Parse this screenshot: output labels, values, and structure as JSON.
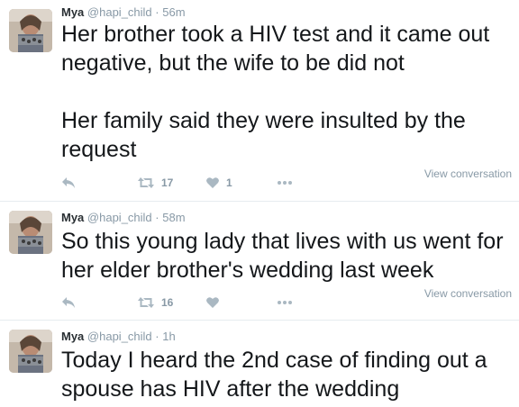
{
  "tweets": [
    {
      "name": "Mya",
      "handle": "@hapi_child",
      "separator": "·",
      "time": "56m",
      "text": "Her brother took a HIV test and it came out negative, but the wife to be did not\n\nHer family said they were insulted by the request",
      "retweets": "17",
      "likes": "1",
      "view_label": "View conversation"
    },
    {
      "name": "Mya",
      "handle": "@hapi_child",
      "separator": "·",
      "time": "58m",
      "text": "So this young lady that lives with us went for her elder brother's wedding last week",
      "retweets": "16",
      "likes": "",
      "view_label": "View conversation"
    },
    {
      "name": "Mya",
      "handle": "@hapi_child",
      "separator": "·",
      "time": "1h",
      "text": "Today I heard the 2nd case of finding out a spouse has HIV after the wedding"
    }
  ],
  "icons": {
    "reply": "reply-icon",
    "retweet": "retweet-icon",
    "like": "heart-icon",
    "more": "more-icon"
  },
  "colors": {
    "icon": "#aab8c2",
    "meta": "#8899a6",
    "text": "#14171a",
    "divider": "#e6ecf0"
  }
}
